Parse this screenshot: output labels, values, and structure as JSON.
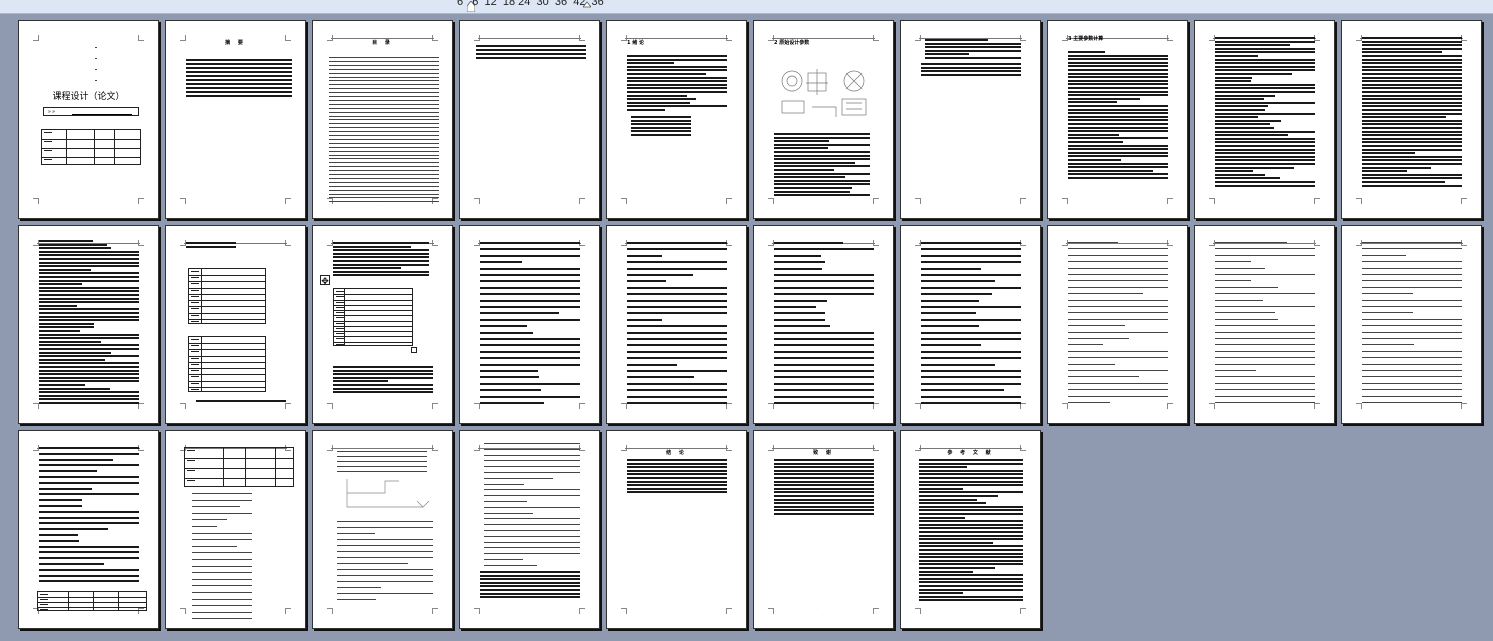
{
  "ruler": {
    "text": "6   6  12  18 24  30  36  42  36"
  },
  "document": {
    "cover_title": "课程设计（论文）",
    "cover_label": "»  »",
    "abstract_heading": "摘  要",
    "contents_heading": "目  录",
    "ch1_heading": "1 绪  论",
    "ch2_heading": "2  原始设计参数",
    "ch3_heading": "3  主要参数计算",
    "conclusion_heading": "结  论",
    "thanks_heading": "致  谢",
    "refs_heading": "参 考 文 献"
  },
  "page_count": 27
}
